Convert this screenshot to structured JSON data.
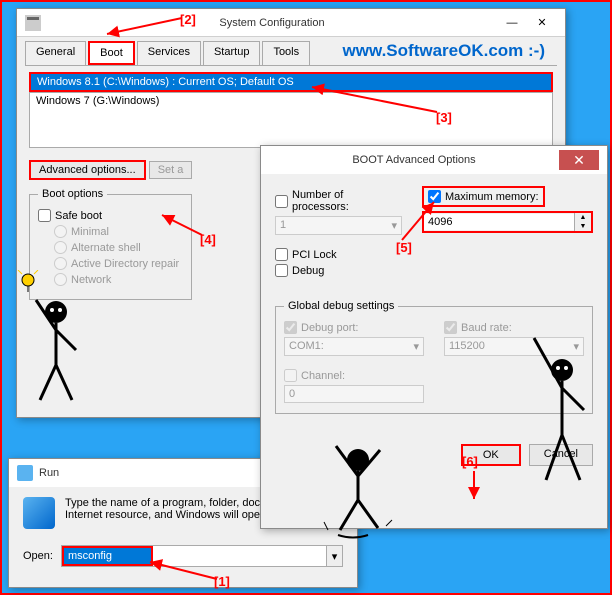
{
  "watermark": "www.SoftwareOK.com :-)",
  "sysconfig": {
    "title": "System Configuration",
    "tabs": [
      "General",
      "Boot",
      "Services",
      "Startup",
      "Tools"
    ],
    "active_tab": "Boot",
    "os_entries": [
      "Windows 8.1 (C:\\Windows) : Current OS; Default OS",
      "Windows 7 (G:\\Windows)"
    ],
    "advanced_btn": "Advanced options...",
    "set_default_btn": "Set a",
    "boot_options_legend": "Boot options",
    "safe_boot": "Safe boot",
    "radios": [
      "Minimal",
      "Alternate shell",
      "Active Directory repair",
      "Network"
    ]
  },
  "bootadv": {
    "title": "BOOT Advanced Options",
    "num_proc_label": "Number of processors:",
    "num_proc_val": "1",
    "max_mem_label": "Maximum memory:",
    "max_mem_val": "4096",
    "pci_lock": "PCI Lock",
    "debug": "Debug",
    "global_legend": "Global debug settings",
    "debug_port_label": "Debug port:",
    "debug_port_val": "COM1:",
    "baud_label": "Baud rate:",
    "baud_val": "115200",
    "channel_label": "Channel:",
    "channel_val": "0",
    "ok": "OK",
    "cancel": "Cancel"
  },
  "run": {
    "title": "Run",
    "desc": "Type the name of a program, folder, document, or Internet resource, and Windows will open it for you.",
    "open_label": "Open:",
    "value": "msconfig"
  },
  "annotations": {
    "a1": "[1]",
    "a2": "[2]",
    "a3": "[3]",
    "a4": "[4]",
    "a5": "[5]",
    "a6": "[6]"
  }
}
